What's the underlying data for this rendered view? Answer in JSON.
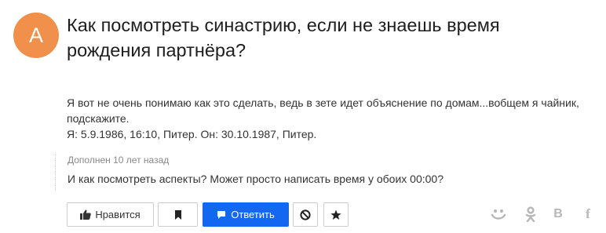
{
  "question": {
    "author_initial": "А",
    "avatar_color": "#f0904a",
    "title": "Как посмотреть синастрию, если не знаешь время рождения партнёра?",
    "body_lines": [
      "Я вот не очень понимаю как это сделать, ведь в зете идет объяснение по домам...вобщем я чайник, подскажите.",
      "Я: 5.9.1986, 16:10, Питер. Он: 30.10.1987, Питер."
    ]
  },
  "addendum": {
    "meta": "Дополнен 10 лет назад",
    "text": "И как посмотреть аспекты? Может просто написать время у обоих 00:00?"
  },
  "actions": {
    "like_label": "Нравится",
    "like_icon": "thumbs-up-icon",
    "bookmark_icon": "bookmark-icon",
    "answer_label": "Ответить",
    "answer_icon": "comment-icon",
    "answer_color": "#1467f0",
    "block_icon": "block-icon",
    "star_icon": "star-icon"
  },
  "share": {
    "icons": [
      "mail-ru-icon",
      "odnoklassniki-icon",
      "vk-icon",
      "facebook-icon"
    ],
    "vk_letter": "В",
    "fb_letter": "f",
    "icon_color": "#b7b7b7"
  }
}
